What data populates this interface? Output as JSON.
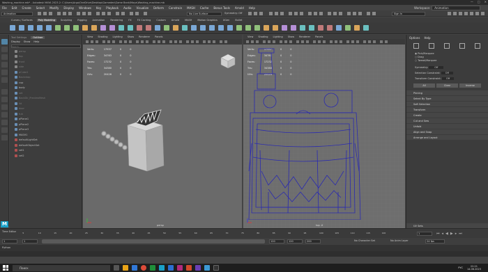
{
  "title": {
    "text": "Washing_machine.mb* - Autodesk MAYA 2023.2: C:\\Users\\Argo\\OneDrive\\Desktop\\Gamedev\\Game Bank\\Maya\\Washing_machine.mb",
    "controls": [
      "—",
      "□",
      "✕"
    ]
  },
  "menubar": [
    "File",
    "Edit",
    "Create",
    "Select",
    "Modify",
    "Display",
    "Windows",
    "Key",
    "Playback",
    "Audio",
    "Visualize",
    "Deform",
    "Constrain",
    "MASH",
    "Cache",
    "Bonus Tools",
    "Arnold",
    "Help"
  ],
  "workspace": {
    "label": "Workspace:",
    "value": "Animation"
  },
  "status": {
    "menuset": "Animation",
    "live_surface": "No Live Surface",
    "symmetry": "Symmetry: Off",
    "sign_in": "Sign In"
  },
  "shelf_tabs": [
    "Curves / Surfaces",
    "Poly Modeling",
    "Sculpting",
    "Rigging",
    "Animation",
    "Rendering",
    "FX",
    "FX Caching",
    "Custom",
    "Arnold",
    "MASH",
    "Motion Graphics",
    "XGen",
    "Bullet"
  ],
  "outliner": {
    "tabs": [
      "Tool Settings",
      "Outliner"
    ],
    "menu": [
      "Display",
      "Show",
      "Help"
    ],
    "search_placeholder": "Search...",
    "items": [
      {
        "label": "persp",
        "dim": true,
        "icon": "camera-icon"
      },
      {
        "label": "top",
        "dim": true,
        "icon": "camera-icon"
      },
      {
        "label": "front",
        "dim": true,
        "icon": "camera-icon"
      },
      {
        "label": "side",
        "dim": true,
        "icon": "camera-icon"
      },
      {
        "label": "pCube1",
        "dim": true,
        "icon": "mesh-icon"
      },
      {
        "label": "Backdrop",
        "dim": true,
        "icon": "mesh-icon"
      },
      {
        "label": "cup",
        "dim": false,
        "icon": "mesh-icon"
      },
      {
        "label": "body",
        "dim": false,
        "icon": "mesh-icon"
      },
      {
        "label": "set",
        "dim": true,
        "icon": "mesh-icon"
      },
      {
        "label": "BackDir_PreviewMesh",
        "dim": true,
        "icon": "mesh-icon"
      },
      {
        "label": "lid",
        "dim": true,
        "icon": "mesh-icon"
      },
      {
        "label": "door",
        "dim": true,
        "icon": "mesh-icon"
      },
      {
        "label": "tub",
        "dim": true,
        "icon": "mesh-icon"
      },
      {
        "label": "pPlane1",
        "dim": false,
        "icon": "mesh-icon"
      },
      {
        "label": "pPlane2",
        "dim": false,
        "icon": "mesh-icon"
      },
      {
        "label": "pPlane3",
        "dim": false,
        "icon": "mesh-icon"
      },
      {
        "label": "MASH1",
        "dim": false,
        "icon": "mash-icon"
      },
      {
        "label": "defaultLightSet",
        "dim": false,
        "icon": "set-icon"
      },
      {
        "label": "defaultObjectSet",
        "dim": false,
        "icon": "set-icon"
      },
      {
        "label": "set1",
        "dim": false,
        "icon": "set-icon"
      },
      {
        "label": "set2",
        "dim": false,
        "icon": "set-icon"
      }
    ]
  },
  "viewport_menu": [
    "View",
    "Shading",
    "Lighting",
    "Show",
    "Renderer",
    "Panels"
  ],
  "hud": {
    "rows": [
      {
        "label": "Verts:",
        "values": [
          "17937",
          "0",
          "0"
        ]
      },
      {
        "label": "Edges:",
        "values": [
          "34763",
          "0",
          "0"
        ]
      },
      {
        "label": "Faces:",
        "values": [
          "17232",
          "0",
          "0"
        ]
      },
      {
        "label": "Tris:",
        "values": [
          "34380",
          "0",
          "0"
        ]
      },
      {
        "label": "UVs:",
        "values": [
          "20426",
          "0",
          "0"
        ]
      }
    ]
  },
  "viewports": {
    "left_label": "persp",
    "right_label": "top -X"
  },
  "right_panel": {
    "tabs": [
      "Options",
      "Help"
    ],
    "options": [
      "Pick/Marquee",
      "Drag",
      "Tweak/Marquee"
    ],
    "symmetry": {
      "label": "Symmetry:",
      "value": "Off"
    },
    "selection_constraint": {
      "label": "Selection Constraint:",
      "value": "Off"
    },
    "transform_constraint": {
      "label": "Transform Constraint:",
      "value": "Off"
    },
    "buttons": [
      "All",
      "Clear",
      "Inverse"
    ],
    "sections": [
      "Pinning",
      "Select By Type",
      "Soft Selection",
      "Transform",
      "Create",
      "Cut and Sew",
      "Unfold",
      "Align and Snap",
      "Arrange and Layout"
    ],
    "uv_sets": "UV Sets"
  },
  "timeline": {
    "ticks": [
      "5",
      "10",
      "15",
      "20",
      "25",
      "30",
      "35",
      "40",
      "45",
      "50",
      "55",
      "60",
      "65",
      "70",
      "75",
      "80",
      "85",
      "90",
      "95",
      "100",
      "105",
      "110",
      "115",
      "120"
    ],
    "current_frame": "1"
  },
  "range": {
    "start": "1",
    "start2": "1",
    "end": "120",
    "end2": "120",
    "end3": "200",
    "character_set": "No Character Set",
    "anim_layer": "No Anim Layer",
    "fps": "24 fps"
  },
  "cmdline": {
    "label": "Python"
  },
  "helpline": {
    "label": "Time Editor"
  },
  "taskbar": {
    "search": "Поиск",
    "tray": [
      "РУС",
      "22:21",
      "14.06.2023"
    ]
  },
  "colors": {
    "wireframe": "#2a2ab0",
    "accent": "#5285a6",
    "viewport": "#6a6a6a"
  }
}
